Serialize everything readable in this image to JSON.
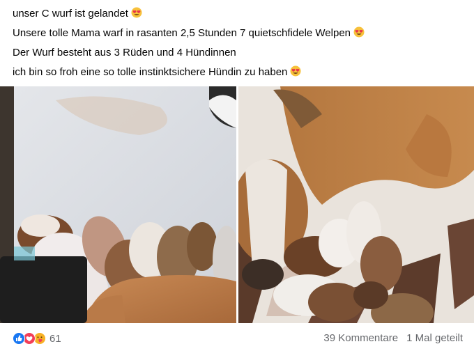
{
  "post": {
    "lines": [
      "unser C wurf ist gelandet",
      "Unsere tolle Mama warf in rasanten 2,5 Stunden 7 quietschfidele Welpen",
      "Der Wurf besteht aus 3 Rüden und 4 Hündinnen",
      "ich bin so froh eine so tolle instinktsichere Hündin zu haben"
    ],
    "line_emoji": [
      "heart-eyes",
      "heart-eyes",
      null,
      "heart-eyes"
    ]
  },
  "photos": [
    {
      "name": "puppies-with-mother-photo-left"
    },
    {
      "name": "puppies-nursing-photo-right"
    }
  ],
  "reactions": {
    "icons": [
      "like-icon",
      "love-icon",
      "care-icon"
    ],
    "count": "61"
  },
  "stats": {
    "comments": "39 Kommentare",
    "shares": "1 Mal geteilt"
  },
  "colors": {
    "like": "#1877f2",
    "love": "#f33e58",
    "care": "#f7b125",
    "secondary_text": "#65676b"
  }
}
